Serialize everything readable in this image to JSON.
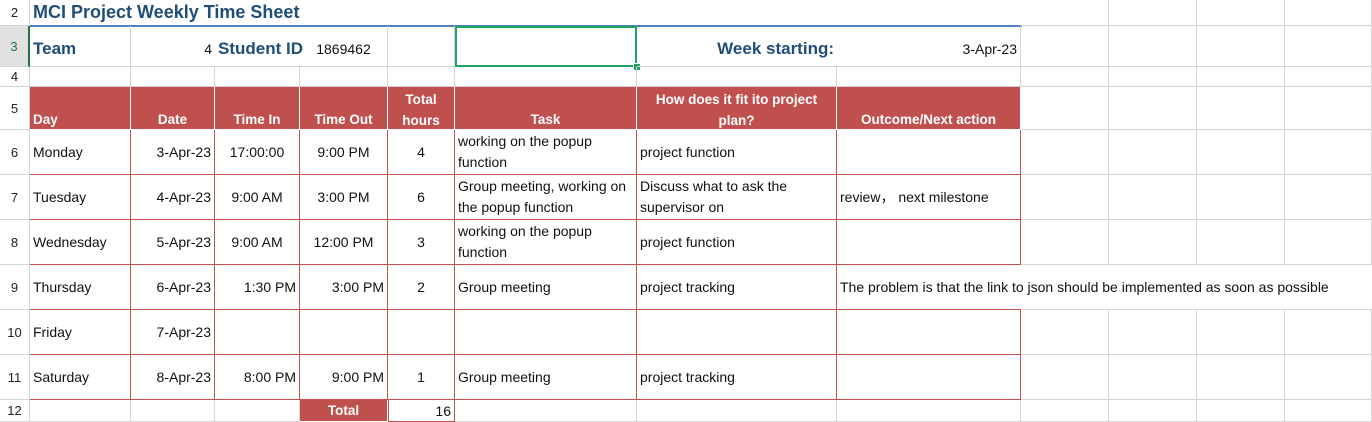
{
  "row_numbers": [
    "2",
    "3",
    "4",
    "5",
    "6",
    "7",
    "8",
    "9",
    "10",
    "11",
    "12"
  ],
  "title": "MCI Project Weekly Time Sheet",
  "info": {
    "team_label": "Team",
    "team_value": "4",
    "student_id_label": "Student ID",
    "student_id_value": "1869462",
    "week_label": "Week starting:",
    "week_value": "3-Apr-23"
  },
  "headers": {
    "day": "Day",
    "date": "Date",
    "time_in": "Time In",
    "time_out": "Time Out",
    "total_hours_line1": "Total",
    "total_hours_line2": "hours",
    "task": "Task",
    "fit_line1": "How does it fit ito project",
    "fit_line2": "plan?",
    "outcome": "Outcome/Next action"
  },
  "rows": [
    {
      "day": "Monday",
      "date": "3-Apr-23",
      "time_in": "17:00:00",
      "time_out": "9:00 PM",
      "hours": "4",
      "task": "working on the popup function",
      "fit": "project function",
      "outcome": ""
    },
    {
      "day": "Tuesday",
      "date": "4-Apr-23",
      "time_in": "9:00 AM",
      "time_out": "3:00 PM",
      "hours": "6",
      "task": "Group meeting, working on the popup function",
      "fit": "Discuss what to ask the supervisor on",
      "outcome": "review， next milestone"
    },
    {
      "day": "Wednesday",
      "date": "5-Apr-23",
      "time_in": "9:00 AM",
      "time_out": "12:00 PM",
      "hours": "3",
      "task": "working on the popup function",
      "fit": "project function",
      "outcome": ""
    },
    {
      "day": "Thursday",
      "date": "6-Apr-23",
      "time_in": "1:30 PM",
      "time_out": "3:00 PM",
      "hours": "2",
      "task": "Group meeting",
      "fit": "project tracking",
      "outcome": "The problem is that the link to json should be implemented as soon as possible"
    },
    {
      "day": "Friday",
      "date": "7-Apr-23",
      "time_in": "",
      "time_out": "",
      "hours": "",
      "task": "",
      "fit": "",
      "outcome": ""
    },
    {
      "day": "Saturday",
      "date": "8-Apr-23",
      "time_in": "8:00 PM",
      "time_out": "9:00 PM",
      "hours": "1",
      "task": "Group meeting",
      "fit": "project tracking",
      "outcome": ""
    }
  ],
  "total": {
    "label": "Total",
    "value": "16"
  },
  "colors": {
    "header_fill": "#c0504d",
    "title_text": "#1f4e79",
    "selection": "#21a366"
  }
}
